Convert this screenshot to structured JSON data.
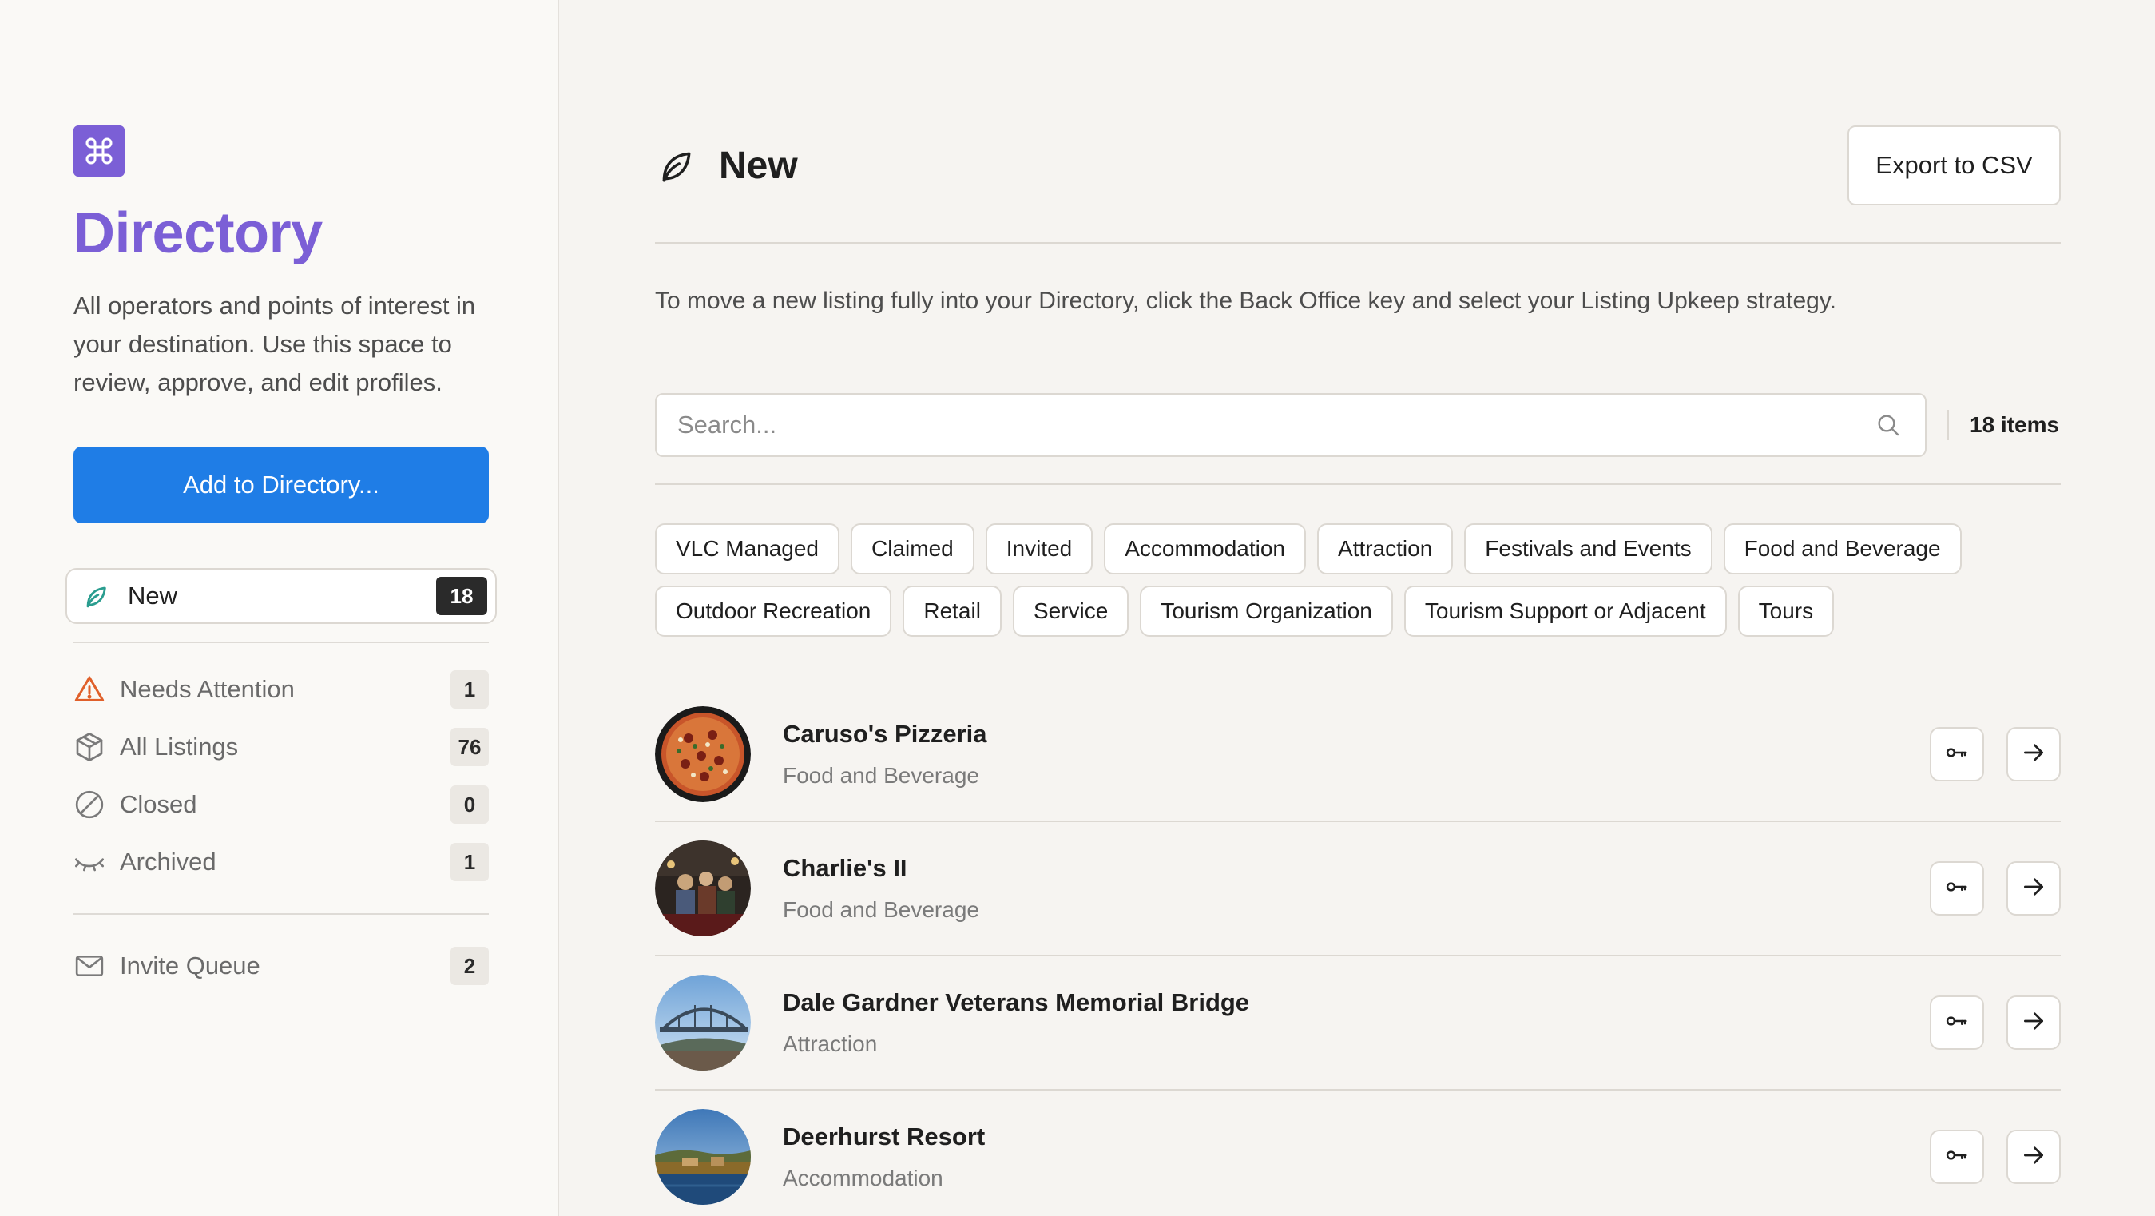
{
  "sidebar": {
    "title": "Directory",
    "description": "All operators and points of interest in your destination. Use this space to review, approve, and edit profiles.",
    "add_button": "Add to Directory...",
    "active": {
      "label": "New",
      "count": "18",
      "icon": "leaf-icon"
    },
    "items": [
      {
        "label": "Needs Attention",
        "count": "1",
        "icon": "warning-icon"
      },
      {
        "label": "All Listings",
        "count": "76",
        "icon": "box-icon"
      },
      {
        "label": "Closed",
        "count": "0",
        "icon": "prohibited-icon"
      },
      {
        "label": "Archived",
        "count": "1",
        "icon": "closed-eye-icon"
      }
    ],
    "invite": {
      "label": "Invite Queue",
      "count": "2",
      "icon": "envelope-icon"
    }
  },
  "main": {
    "title": "New",
    "export_button": "Export to CSV",
    "hint": "To move a new listing fully into your Directory, click the Back Office key and select your Listing Upkeep strategy.",
    "search_placeholder": "Search...",
    "item_count": "18 items",
    "tags": [
      "VLC Managed",
      "Claimed",
      "Invited",
      "Accommodation",
      "Attraction",
      "Festivals and Events",
      "Food and Beverage",
      "Outdoor Recreation",
      "Retail",
      "Service",
      "Tourism Organization",
      "Tourism Support or Adjacent",
      "Tours"
    ],
    "listings": [
      {
        "name": "Caruso's Pizzeria",
        "category": "Food and Beverage"
      },
      {
        "name": "Charlie's II",
        "category": "Food and Beverage"
      },
      {
        "name": "Dale Gardner Veterans Memorial Bridge",
        "category": "Attraction"
      },
      {
        "name": "Deerhurst Resort",
        "category": "Accommodation"
      }
    ]
  },
  "colors": {
    "accent_purple": "#7b5fd6",
    "primary_blue": "#1f7de6",
    "warning_orange": "#e0602a",
    "leaf_teal": "#2a9d8f"
  }
}
